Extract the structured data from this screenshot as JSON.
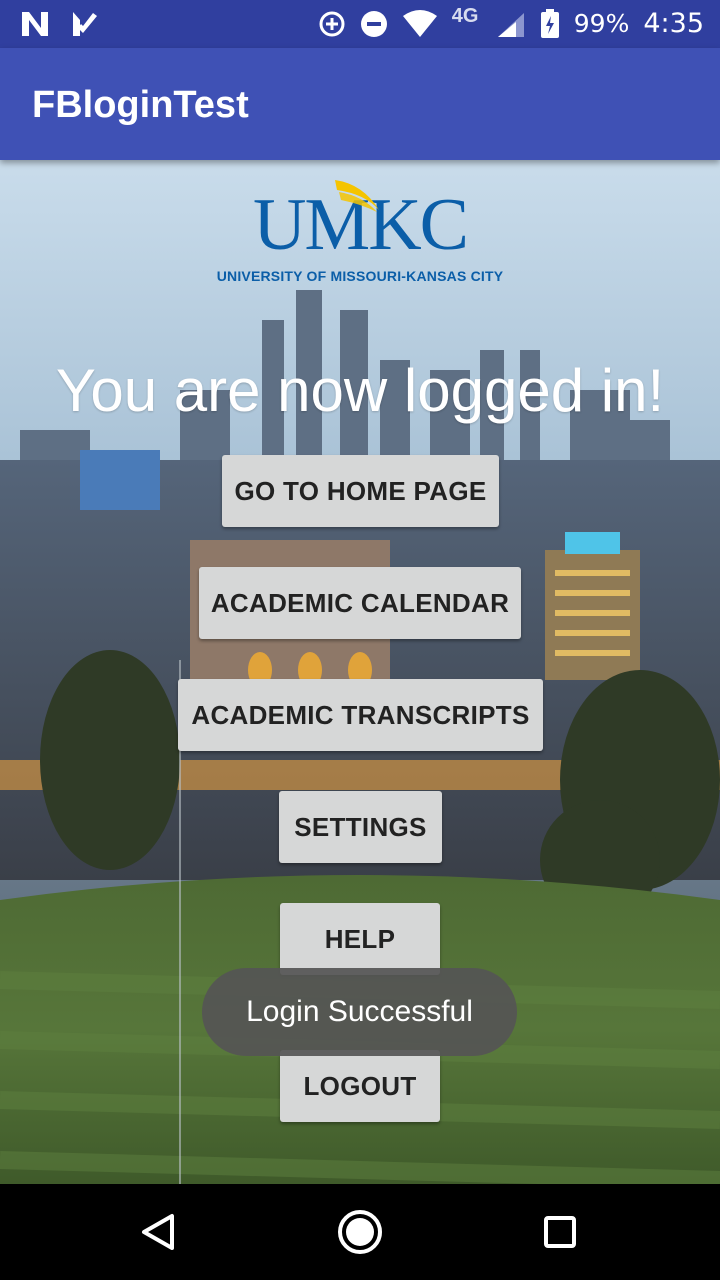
{
  "status_bar": {
    "left_icons": [
      "n-notification-icon",
      "check-notification-icon"
    ],
    "right_icons": [
      "data-saver-icon",
      "dnd-icon",
      "wifi-icon",
      "lte-signal-icon",
      "battery-icon"
    ],
    "network_label": "4G",
    "battery": "99%",
    "time": "4:35"
  },
  "app_bar": {
    "title": "FBloginTest"
  },
  "logo": {
    "word": "UMKC",
    "subtitle": "UNIVERSITY OF MISSOURI-KANSAS CITY"
  },
  "main": {
    "headline": "You are now logged in!",
    "buttons": {
      "home": "GO TO HOME PAGE",
      "calendar": "ACADEMIC CALENDAR",
      "transcripts": "ACADEMIC TRANSCRIPTS",
      "settings": "SETTINGS",
      "help": "HELP",
      "logout": "LOGOUT"
    }
  },
  "toast": {
    "message": "Login Successful"
  },
  "nav_bar": {
    "icons": [
      "back-icon",
      "home-icon",
      "recents-icon"
    ]
  },
  "colors": {
    "primary": "#3F51B5",
    "primary_dark": "#303F9F",
    "button": "#D6D7D7",
    "logo_blue": "#0B5EA8",
    "logo_gold": "#F5C400"
  }
}
